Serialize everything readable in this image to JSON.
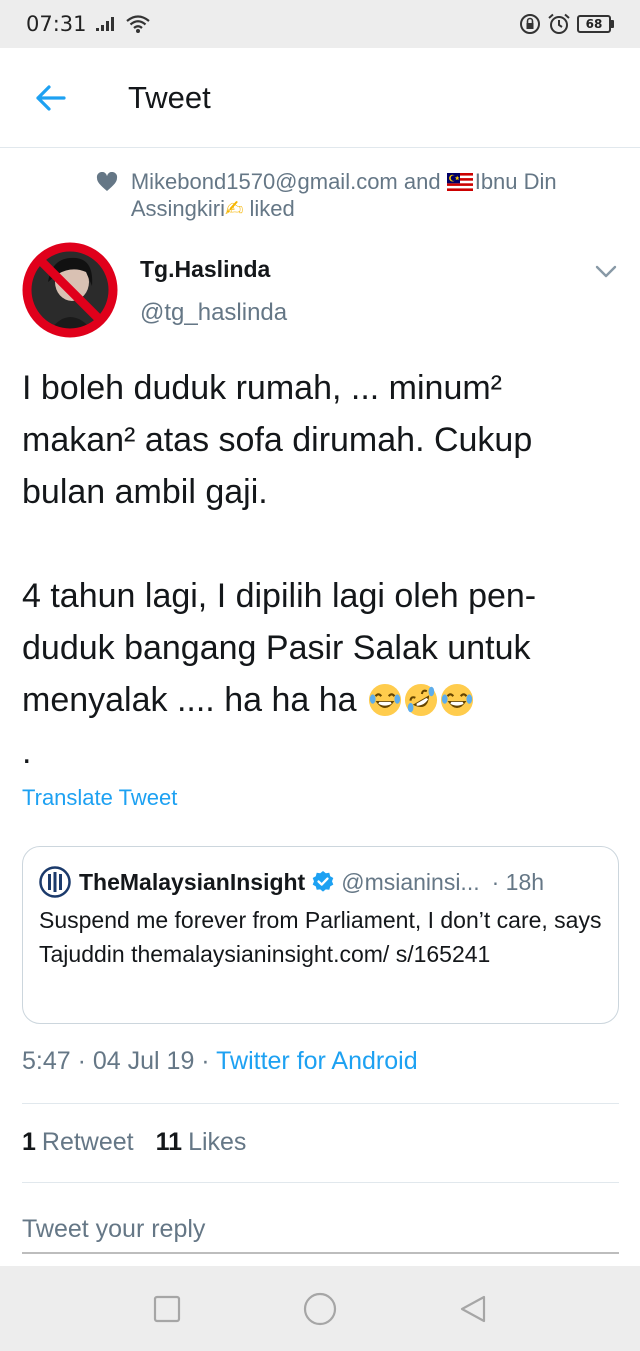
{
  "status_bar": {
    "time": "07:31",
    "battery": "68",
    "icons": [
      "signal-icon",
      "wifi-icon",
      "lock-rotation-icon",
      "alarm-icon",
      "battery-icon"
    ]
  },
  "header": {
    "back_icon": "arrow-left-icon",
    "title": "Tweet"
  },
  "social_context": {
    "icon": "heart-icon",
    "user_one": "Mikebond1570@gmail.com",
    "conjunction": " and ",
    "user_two": "Ibnu Din Assingkiri",
    "user_two_emoji": "✍",
    "suffix": " liked"
  },
  "author": {
    "name": "Tg.Haslinda",
    "handle": "@tg_haslinda"
  },
  "tweet": {
    "text": "I boleh duduk rumah, ... minum² makan² atas sofa dirumah. Cukup bulan ambil gaji.\n\n4 tahun lagi, I dipilih lagi oleh pen-duduk bangang Pasir Salak untuk menyalak .... ha ha ha",
    "trailing": "\n.",
    "emojis": [
      "laughing-face-emoji",
      "rolling-laughing-face-emoji",
      "laughing-face-emoji"
    ],
    "translate_label": "Translate Tweet"
  },
  "quote": {
    "name": "TheMalaysianInsight",
    "handle": "@msianinsi...",
    "time": "· 18h",
    "text": "Suspend me forever from Parliament, I don’t care, says Tajuddin themalaysianinsight.com/ s/165241"
  },
  "meta": {
    "time": "5:47",
    "sep1": " · ",
    "date": "04 Jul 19",
    "sep2": " · ",
    "source": "Twitter for Android"
  },
  "stats": {
    "retweet_count": "1",
    "retweet_label": "Retweet",
    "likes_count": "11",
    "likes_label": "Likes"
  },
  "reply": {
    "placeholder": "Tweet your reply"
  },
  "colors": {
    "accent": "#1da1f2",
    "secondary_text": "#657786",
    "primary_text": "#14171a",
    "divider": "#e1e8ed",
    "system_bar": "#ededed"
  }
}
